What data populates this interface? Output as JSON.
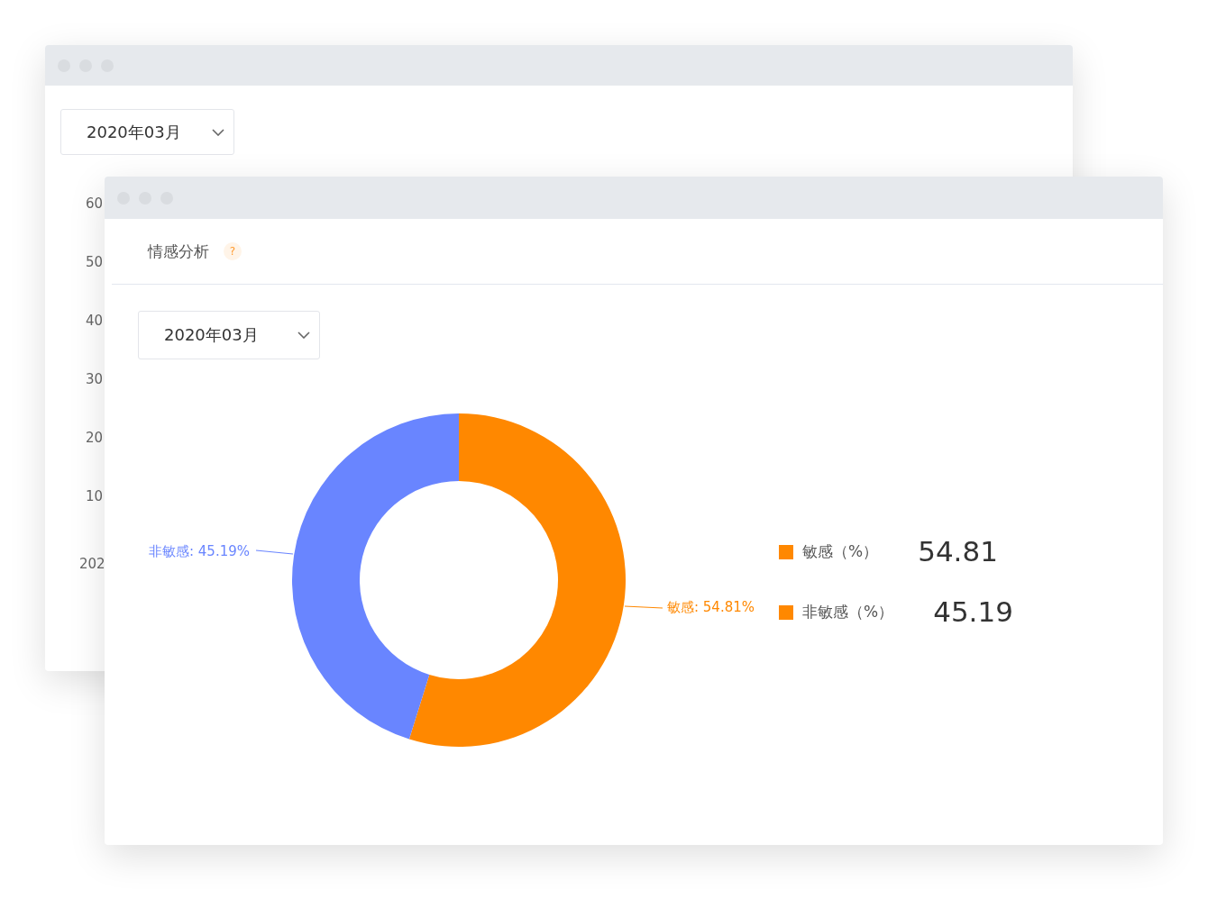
{
  "back_window": {
    "date_select": {
      "value": "2020年03月"
    },
    "y_axis_labels": [
      "60",
      "50",
      "40",
      "30",
      "20",
      "10"
    ],
    "x_axis_labels": [
      "202"
    ]
  },
  "front_window": {
    "title": "情感分析",
    "help": "?",
    "date_select": {
      "value": "2020年03月"
    },
    "chart_data": {
      "type": "donut",
      "values": [
        54.81,
        45.19
      ],
      "value_labels": [
        "敏感: 54.81%",
        "非敏感: 45.19%"
      ]
    },
    "slices": [
      {
        "color": "#ff8800"
      },
      {
        "color": "#6985ff"
      }
    ],
    "legend": [
      {
        "label": "敏感（%）",
        "value": "54.81",
        "color": "#ff8800"
      },
      {
        "label": "非敏感（%）",
        "value": "45.19",
        "color": "#ff8800"
      }
    ]
  }
}
